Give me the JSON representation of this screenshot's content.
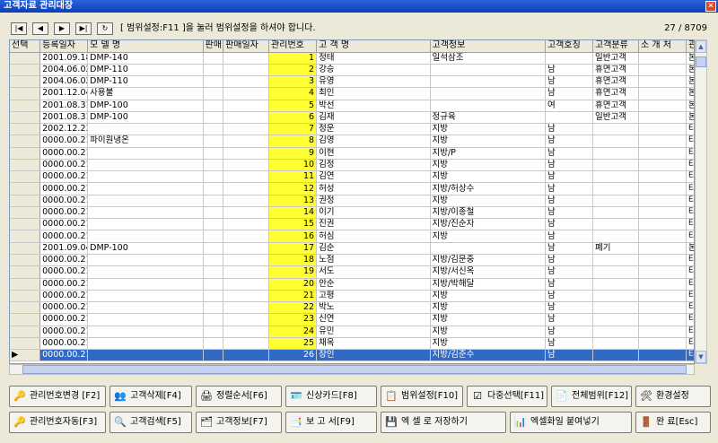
{
  "window": {
    "title": "고객자료 관리대장"
  },
  "toolbar": {
    "hint": "[ 범위설정:F11 ]을 눌러 범위설정을 하셔야 합니다.",
    "record_count": "27 / 8709"
  },
  "columns": [
    "선택",
    "등록일자",
    "모 델 명",
    "판매",
    "판매일자",
    "관리번호",
    "고 객 명",
    "고객정보",
    "고객호칭",
    "고객분류",
    "소 개 처",
    "관리"
  ],
  "rows": [
    [
      "",
      "2001.09.18",
      "DMP-140",
      "",
      "",
      "1",
      "정태",
      "일석삼조",
      "",
      "일반고객",
      "",
      "본사"
    ],
    [
      "",
      "2004.06.02",
      "DMP-110",
      "",
      "",
      "2",
      "강승",
      "",
      "남",
      "휴면고객",
      "",
      "본사"
    ],
    [
      "",
      "2004.06.02",
      "DMP-110",
      "",
      "",
      "3",
      "유영",
      "",
      "남",
      "휴면고객",
      "",
      "본사"
    ],
    [
      "",
      "2001.12.04",
      "사용불",
      "",
      "",
      "4",
      "최인",
      "",
      "남",
      "휴면고객",
      "",
      "본사"
    ],
    [
      "",
      "2001.08.31",
      "DMP-100",
      "",
      "",
      "5",
      "박선",
      "",
      "여",
      "휴면고객",
      "",
      "본사"
    ],
    [
      "",
      "2001.08.31",
      "DMP-100",
      "",
      "",
      "6",
      "김재",
      "정규육",
      "",
      "일반고객",
      "",
      "본사"
    ],
    [
      "",
      "2002.12.23",
      "",
      "",
      "",
      "7",
      "정운",
      "지방",
      "남",
      "",
      "",
      "타사"
    ],
    [
      "",
      "0000.00.21",
      "파이원냉온",
      "",
      "",
      "8",
      "김영",
      "지방",
      "남",
      "",
      "",
      "타사"
    ],
    [
      "",
      "0000.00.21",
      "",
      "",
      "",
      "9",
      "이현",
      "지방/P",
      "남",
      "",
      "",
      "타사"
    ],
    [
      "",
      "0000.00.21",
      "",
      "",
      "",
      "10",
      "김정",
      "지방",
      "남",
      "",
      "",
      "타사"
    ],
    [
      "",
      "0000.00.21",
      "",
      "",
      "",
      "11",
      "김연",
      "지방",
      "남",
      "",
      "",
      "타사"
    ],
    [
      "",
      "0000.00.21",
      "",
      "",
      "",
      "12",
      "허성",
      "지방/허상수",
      "남",
      "",
      "",
      "타사"
    ],
    [
      "",
      "0000.00.21",
      "",
      "",
      "",
      "13",
      "권정",
      "지방",
      "남",
      "",
      "",
      "타사"
    ],
    [
      "",
      "0000.00.21",
      "",
      "",
      "",
      "14",
      "이기",
      "지방/이종철",
      "남",
      "",
      "",
      "타사"
    ],
    [
      "",
      "0000.00.21",
      "",
      "",
      "",
      "15",
      "진권",
      "지방/진순자",
      "남",
      "",
      "",
      "타사"
    ],
    [
      "",
      "0000.00.21",
      "",
      "",
      "",
      "16",
      "허심",
      "지방",
      "남",
      "",
      "",
      "타사"
    ],
    [
      "",
      "2001.09.04",
      "DMP-100",
      "",
      "",
      "17",
      "김순",
      "",
      "남",
      "폐기",
      "",
      "본사"
    ],
    [
      "",
      "0000.00.21",
      "",
      "",
      "",
      "18",
      "노점",
      "지방/김문중",
      "남",
      "",
      "",
      "타사"
    ],
    [
      "",
      "0000.00.21",
      "",
      "",
      "",
      "19",
      "서도",
      "지방/서신옥",
      "남",
      "",
      "",
      "타사"
    ],
    [
      "",
      "0000.00.21",
      "",
      "",
      "",
      "20",
      "안순",
      "지방/박해달",
      "남",
      "",
      "",
      "타사"
    ],
    [
      "",
      "0000.00.21",
      "",
      "",
      "",
      "21",
      "고평",
      "지방",
      "남",
      "",
      "",
      "타사"
    ],
    [
      "",
      "0000.00.21",
      "",
      "",
      "",
      "22",
      "박노",
      "지방",
      "남",
      "",
      "",
      "타사"
    ],
    [
      "",
      "0000.00.21",
      "",
      "",
      "",
      "23",
      "신연",
      "지방",
      "남",
      "",
      "",
      "타사"
    ],
    [
      "",
      "0000.00.21",
      "",
      "",
      "",
      "24",
      "유민",
      "지방",
      "남",
      "",
      "",
      "타사"
    ],
    [
      "",
      "0000.00.21",
      "",
      "",
      "",
      "25",
      "채옥",
      "지방",
      "남",
      "",
      "",
      "타사"
    ],
    [
      "▶",
      "0000.00.21",
      "",
      "",
      "",
      "26",
      "장인",
      "지방/김준수",
      "남",
      "",
      "",
      "타사"
    ]
  ],
  "buttons_row1": [
    {
      "label": "관리번호변경 [F2]",
      "icon": "key-icon",
      "glyph": "🔑"
    },
    {
      "label": "고객삭제[F4]",
      "icon": "users-delete-icon",
      "glyph": "👥"
    },
    {
      "label": "정렬순서[F6]",
      "icon": "printer-icon",
      "glyph": "🖨"
    },
    {
      "label": "신상카드[F8]",
      "icon": "card-icon",
      "glyph": "🪪"
    },
    {
      "label": "범위설정[F10]",
      "icon": "calendar-icon",
      "glyph": "📋"
    },
    {
      "label": "다중선택[F11]",
      "icon": "checklist-icon",
      "glyph": "☑"
    },
    {
      "label": "전체범위[F12]",
      "icon": "document-icon",
      "glyph": "📄"
    },
    {
      "label": "환경설정",
      "icon": "tools-icon",
      "glyph": "🛠"
    }
  ],
  "buttons_row2": [
    {
      "label": "관리번호자동[F3]",
      "icon": "key-icon",
      "glyph": "🔑"
    },
    {
      "label": "고객검색[F5]",
      "icon": "search-user-icon",
      "glyph": "🔍"
    },
    {
      "label": "고객정보[F7]",
      "icon": "info-card-icon",
      "glyph": "🗂"
    },
    {
      "label": "보 고 서[F9]",
      "icon": "report-icon",
      "glyph": "📑"
    },
    {
      "label": "엑 셀 로 저장하기",
      "icon": "excel-save-icon",
      "glyph": "💾"
    },
    {
      "label": "엑셀화일 붙여넣기",
      "icon": "excel-paste-icon",
      "glyph": "📊"
    },
    {
      "label": "완 료[Esc]",
      "icon": "exit-door-icon",
      "glyph": "🚪"
    }
  ]
}
